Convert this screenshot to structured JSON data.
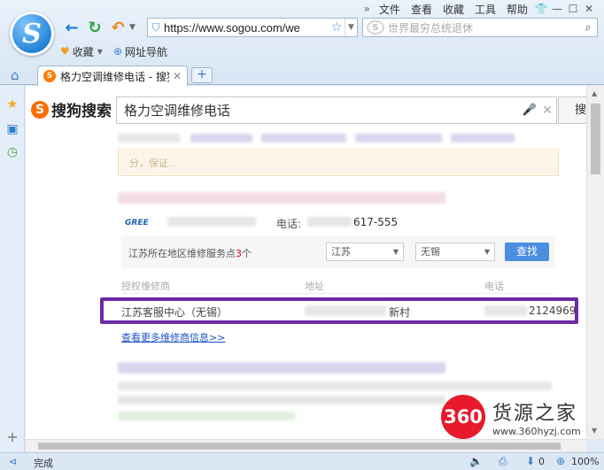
{
  "menu": {
    "items": [
      "文件",
      "查看",
      "收藏",
      "工具",
      "帮助"
    ]
  },
  "address": {
    "url": "https://www.sogou.com/we"
  },
  "browser_search": {
    "placeholder": "世界最穷总统退休"
  },
  "bookmarks": {
    "favorites": "收藏",
    "nav": "网址导航"
  },
  "tab": {
    "title": "格力空调维修电话 - 搜狗"
  },
  "page": {
    "logo_text": "搜狗搜索",
    "query": "格力空调维修电话",
    "search_btn": "搜",
    "notice_text": "分，保证...",
    "brand": "GREE",
    "phone_label": "电话:",
    "phone_value": "617-555",
    "service_label_prefix": "江苏所在地区维修服务点",
    "service_count": "3",
    "service_label_suffix": "个",
    "province": "江苏",
    "city": "无锡",
    "find_btn": "查找",
    "table_headers": [
      "授权维修商",
      "地址",
      "电话"
    ],
    "row": {
      "name": "江苏客服中心（无锡）",
      "address": "新村",
      "phone": "2124969"
    },
    "more_link": "查看更多维修商信息>>"
  },
  "watermark": {
    "badge": "360",
    "name": "货源之家",
    "url": "www.360hyzj.com"
  },
  "status": {
    "text": "完成",
    "zoom": "100%",
    "count": "0"
  }
}
